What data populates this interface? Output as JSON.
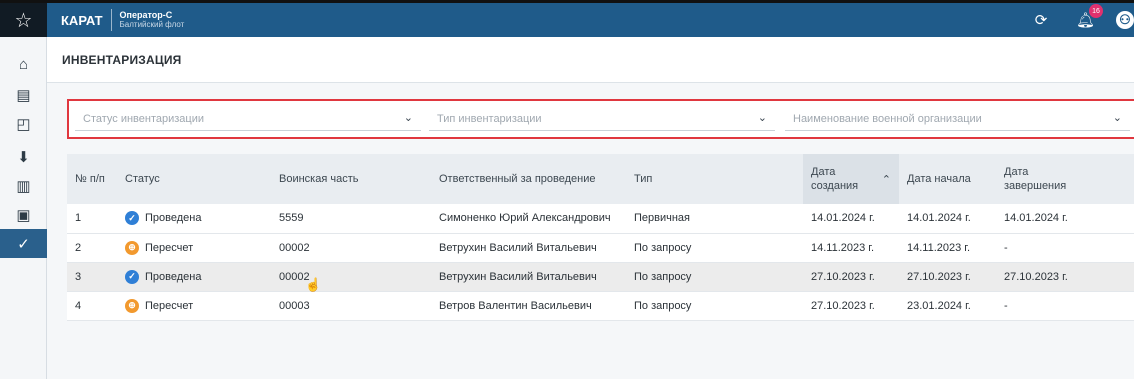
{
  "header": {
    "brand": "КАРАТ",
    "operator": "Оператор-С",
    "fleet": "Балтийский флот",
    "notification_count": "16"
  },
  "icons": {
    "favorite": "star-icon",
    "refresh": "refresh-icon",
    "notifications": "bell-icon",
    "user": "user-icon"
  },
  "sidebar": {
    "items": [
      {
        "name": "home-icon",
        "glyph": "⌂"
      },
      {
        "name": "document-icon",
        "glyph": "▤"
      },
      {
        "name": "bookmark-icon",
        "glyph": "◰"
      },
      {
        "name": "download-icon",
        "glyph": "⬇"
      },
      {
        "name": "map-icon",
        "glyph": "▥"
      },
      {
        "name": "calendar-settings-icon",
        "glyph": "▣"
      },
      {
        "name": "clipboard-check-icon",
        "glyph": "✓",
        "active": true
      }
    ]
  },
  "page": {
    "title": "ИНВЕНТАРИЗАЦИЯ"
  },
  "filters": {
    "status_placeholder": "Статус инвентаризации",
    "type_placeholder": "Тип инвентаризации",
    "org_placeholder": "Наименование военной организации"
  },
  "table": {
    "columns": [
      "№ п/п",
      "Статус",
      "Воинская часть",
      "Ответственный за проведение",
      "Тип",
      "Дата создания",
      "Дата начала",
      "Дата завершения"
    ],
    "rows": [
      {
        "num": "1",
        "status": "Проведена",
        "status_kind": "done",
        "unit": "5559",
        "responsible": "Симоненко Юрий Александрович",
        "type": "Первичная",
        "created": "14.01.2024 г.",
        "start": "14.01.2024 г.",
        "end": "14.01.2024 г."
      },
      {
        "num": "2",
        "status": "Пересчет",
        "status_kind": "recount",
        "unit": "00002",
        "responsible": "Ветрухин Василий Витальевич",
        "type": "По запросу",
        "created": "14.11.2023 г.",
        "start": "14.11.2023 г.",
        "end": "-"
      },
      {
        "num": "3",
        "status": "Проведена",
        "status_kind": "done",
        "unit": "00002",
        "responsible": "Ветрухин Василий Витальевич",
        "type": "По запросу",
        "created": "27.10.2023 г.",
        "start": "27.10.2023 г.",
        "end": "27.10.2023 г.",
        "highlighted": true
      },
      {
        "num": "4",
        "status": "Пересчет",
        "status_kind": "recount",
        "unit": "00003",
        "responsible": "Ветров Валентин Васильевич",
        "type": "По запросу",
        "created": "27.10.2023 г.",
        "start": "23.01.2024 г.",
        "end": "-"
      }
    ]
  },
  "colors": {
    "topbar": "#1f5b8a",
    "accent_red": "#e0373f",
    "status_done": "#2f7fd6",
    "status_recount": "#f2992e"
  }
}
